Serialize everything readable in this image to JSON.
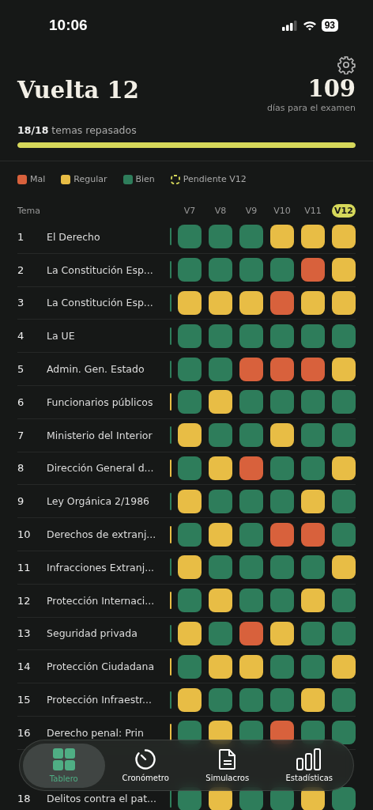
{
  "status_bar": {
    "time": "10:06",
    "battery": "93"
  },
  "header": {
    "title": "Vuelta 12",
    "days": "109",
    "days_label": "días para el examen"
  },
  "progress": {
    "count": "18/18",
    "label": "temas repasados",
    "level": 1
  },
  "legend": [
    {
      "kind": "dot",
      "label": "Mal",
      "color": "#d8613c"
    },
    {
      "kind": "dot",
      "label": "Regular",
      "color": "#e8bd45"
    },
    {
      "kind": "dot",
      "label": "Bien",
      "color": "#2e7d5b"
    },
    {
      "kind": "pending",
      "label": "Pendiente V12",
      "color": "#d6d85a"
    }
  ],
  "table": {
    "column_label": "Tema",
    "rounds": [
      {
        "label": "V7",
        "selected": false
      },
      {
        "label": "V8",
        "selected": false
      },
      {
        "label": "V9",
        "selected": false
      },
      {
        "label": "V10",
        "selected": false
      },
      {
        "label": "V11",
        "selected": false
      },
      {
        "label": "V12",
        "selected": true
      }
    ],
    "rows": [
      {
        "number": "1",
        "title": "El Derecho",
        "marker": {
          "color": "#2e7d5b"
        },
        "cells": [
          {
            "color": "#2e7d5b"
          },
          {
            "color": "#2e7d5b"
          },
          {
            "color": "#2e7d5b"
          },
          {
            "color": "#e8bd45"
          },
          {
            "color": "#e8bd45"
          },
          {
            "color": "#e8bd45"
          }
        ]
      },
      {
        "number": "2",
        "title": "La Constitución Esp...",
        "marker": {
          "color": "#2e7d5b"
        },
        "cells": [
          {
            "color": "#2e7d5b"
          },
          {
            "color": "#2e7d5b"
          },
          {
            "color": "#2e7d5b"
          },
          {
            "color": "#2e7d5b"
          },
          {
            "color": "#d8613c"
          },
          {
            "color": "#e8bd45"
          }
        ]
      },
      {
        "number": "3",
        "title": "La Constitución Esp...",
        "marker": {
          "color": "#2e7d5b"
        },
        "cells": [
          {
            "color": "#e8bd45"
          },
          {
            "color": "#e8bd45"
          },
          {
            "color": "#e8bd45"
          },
          {
            "color": "#d8613c"
          },
          {
            "color": "#e8bd45"
          },
          {
            "color": "#e8bd45"
          }
        ]
      },
      {
        "number": "4",
        "title": "La UE",
        "marker": {
          "color": "#2e7d5b"
        },
        "cells": [
          {
            "color": "#2e7d5b"
          },
          {
            "color": "#2e7d5b"
          },
          {
            "color": "#2e7d5b"
          },
          {
            "color": "#2e7d5b"
          },
          {
            "color": "#2e7d5b"
          },
          {
            "color": "#2e7d5b"
          }
        ]
      },
      {
        "number": "5",
        "title": "Admin. Gen. Estado",
        "marker": {
          "color": "#2e7d5b"
        },
        "cells": [
          {
            "color": "#2e7d5b"
          },
          {
            "color": "#2e7d5b"
          },
          {
            "color": "#d8613c"
          },
          {
            "color": "#d8613c"
          },
          {
            "color": "#d8613c"
          },
          {
            "color": "#e8bd45"
          }
        ]
      },
      {
        "number": "6",
        "title": "Funcionarios públicos",
        "marker": {
          "color": "#e8bd45"
        },
        "cells": [
          {
            "color": "#2e7d5b"
          },
          {
            "color": "#e8bd45"
          },
          {
            "color": "#2e7d5b"
          },
          {
            "color": "#2e7d5b"
          },
          {
            "color": "#2e7d5b"
          },
          {
            "color": "#2e7d5b"
          }
        ]
      },
      {
        "number": "7",
        "title": "Ministerio del Interior",
        "marker": {
          "color": "#2e7d5b"
        },
        "cells": [
          {
            "color": "#e8bd45"
          },
          {
            "color": "#2e7d5b"
          },
          {
            "color": "#2e7d5b"
          },
          {
            "color": "#e8bd45"
          },
          {
            "color": "#2e7d5b"
          },
          {
            "color": "#2e7d5b"
          }
        ]
      },
      {
        "number": "8",
        "title": "Dirección General d...",
        "marker": {
          "color": "#e8bd45"
        },
        "cells": [
          {
            "color": "#2e7d5b"
          },
          {
            "color": "#e8bd45"
          },
          {
            "color": "#d8613c"
          },
          {
            "color": "#2e7d5b"
          },
          {
            "color": "#2e7d5b"
          },
          {
            "color": "#e8bd45"
          }
        ]
      },
      {
        "number": "9",
        "title": "Ley Orgánica 2/1986",
        "marker": {
          "color": "#2e7d5b"
        },
        "cells": [
          {
            "color": "#e8bd45"
          },
          {
            "color": "#2e7d5b"
          },
          {
            "color": "#2e7d5b"
          },
          {
            "color": "#2e7d5b"
          },
          {
            "color": "#e8bd45"
          },
          {
            "color": "#2e7d5b"
          }
        ]
      },
      {
        "number": "10",
        "title": "Derechos de extranj...",
        "marker": {
          "color": "#e8bd45"
        },
        "cells": [
          {
            "color": "#2e7d5b"
          },
          {
            "color": "#e8bd45"
          },
          {
            "color": "#2e7d5b"
          },
          {
            "color": "#d8613c"
          },
          {
            "color": "#d8613c"
          },
          {
            "color": "#2e7d5b"
          }
        ]
      },
      {
        "number": "11",
        "title": "Infracciones Extranj...",
        "marker": {
          "color": "#2e7d5b"
        },
        "cells": [
          {
            "color": "#e8bd45"
          },
          {
            "color": "#2e7d5b"
          },
          {
            "color": "#2e7d5b"
          },
          {
            "color": "#2e7d5b"
          },
          {
            "color": "#2e7d5b"
          },
          {
            "color": "#e8bd45"
          }
        ]
      },
      {
        "number": "12",
        "title": "Protección Internaci...",
        "marker": {
          "color": "#e8bd45"
        },
        "cells": [
          {
            "color": "#2e7d5b"
          },
          {
            "color": "#e8bd45"
          },
          {
            "color": "#2e7d5b"
          },
          {
            "color": "#2e7d5b"
          },
          {
            "color": "#e8bd45"
          },
          {
            "color": "#2e7d5b"
          }
        ]
      },
      {
        "number": "13",
        "title": "Seguridad privada",
        "marker": {
          "color": "#2e7d5b"
        },
        "cells": [
          {
            "color": "#e8bd45"
          },
          {
            "color": "#2e7d5b"
          },
          {
            "color": "#d8613c"
          },
          {
            "color": "#e8bd45"
          },
          {
            "color": "#2e7d5b"
          },
          {
            "color": "#2e7d5b"
          }
        ]
      },
      {
        "number": "14",
        "title": "Protección Ciudadana",
        "marker": {
          "color": "#e8bd45"
        },
        "cells": [
          {
            "color": "#2e7d5b"
          },
          {
            "color": "#e8bd45"
          },
          {
            "color": "#e8bd45"
          },
          {
            "color": "#2e7d5b"
          },
          {
            "color": "#2e7d5b"
          },
          {
            "color": "#e8bd45"
          }
        ]
      },
      {
        "number": "15",
        "title": "Protección Infraestr...",
        "marker": {
          "color": "#2e7d5b"
        },
        "cells": [
          {
            "color": "#e8bd45"
          },
          {
            "color": "#2e7d5b"
          },
          {
            "color": "#2e7d5b"
          },
          {
            "color": "#2e7d5b"
          },
          {
            "color": "#e8bd45"
          },
          {
            "color": "#2e7d5b"
          }
        ]
      },
      {
        "number": "16",
        "title": "Derecho penal: Prin",
        "marker": {
          "color": "#e8bd45"
        },
        "cells": [
          {
            "color": "#2e7d5b"
          },
          {
            "color": "#e8bd45"
          },
          {
            "color": "#2e7d5b"
          },
          {
            "color": "#d8613c"
          },
          {
            "color": "#2e7d5b"
          },
          {
            "color": "#2e7d5b"
          }
        ]
      },
      {
        "number": "18",
        "title": "Delitos contra el pat...",
        "marker": {
          "color": "#2e7d5b"
        },
        "cells": [
          {
            "color": "#2e7d5b"
          },
          {
            "color": "#e8bd45"
          },
          {
            "color": "#2e7d5b"
          },
          {
            "color": "#2e7d5b"
          },
          {
            "color": "#e8bd45"
          },
          {
            "color": "#2e7d5b"
          }
        ]
      }
    ]
  },
  "nav": [
    {
      "kind": "grid",
      "label": "Tablero",
      "selected": true
    },
    {
      "kind": "timer",
      "label": "Cronómetro",
      "selected": false
    },
    {
      "kind": "document",
      "label": "Simulacros",
      "selected": false
    },
    {
      "kind": "bars",
      "label": "Estadísticas",
      "selected": false
    }
  ]
}
